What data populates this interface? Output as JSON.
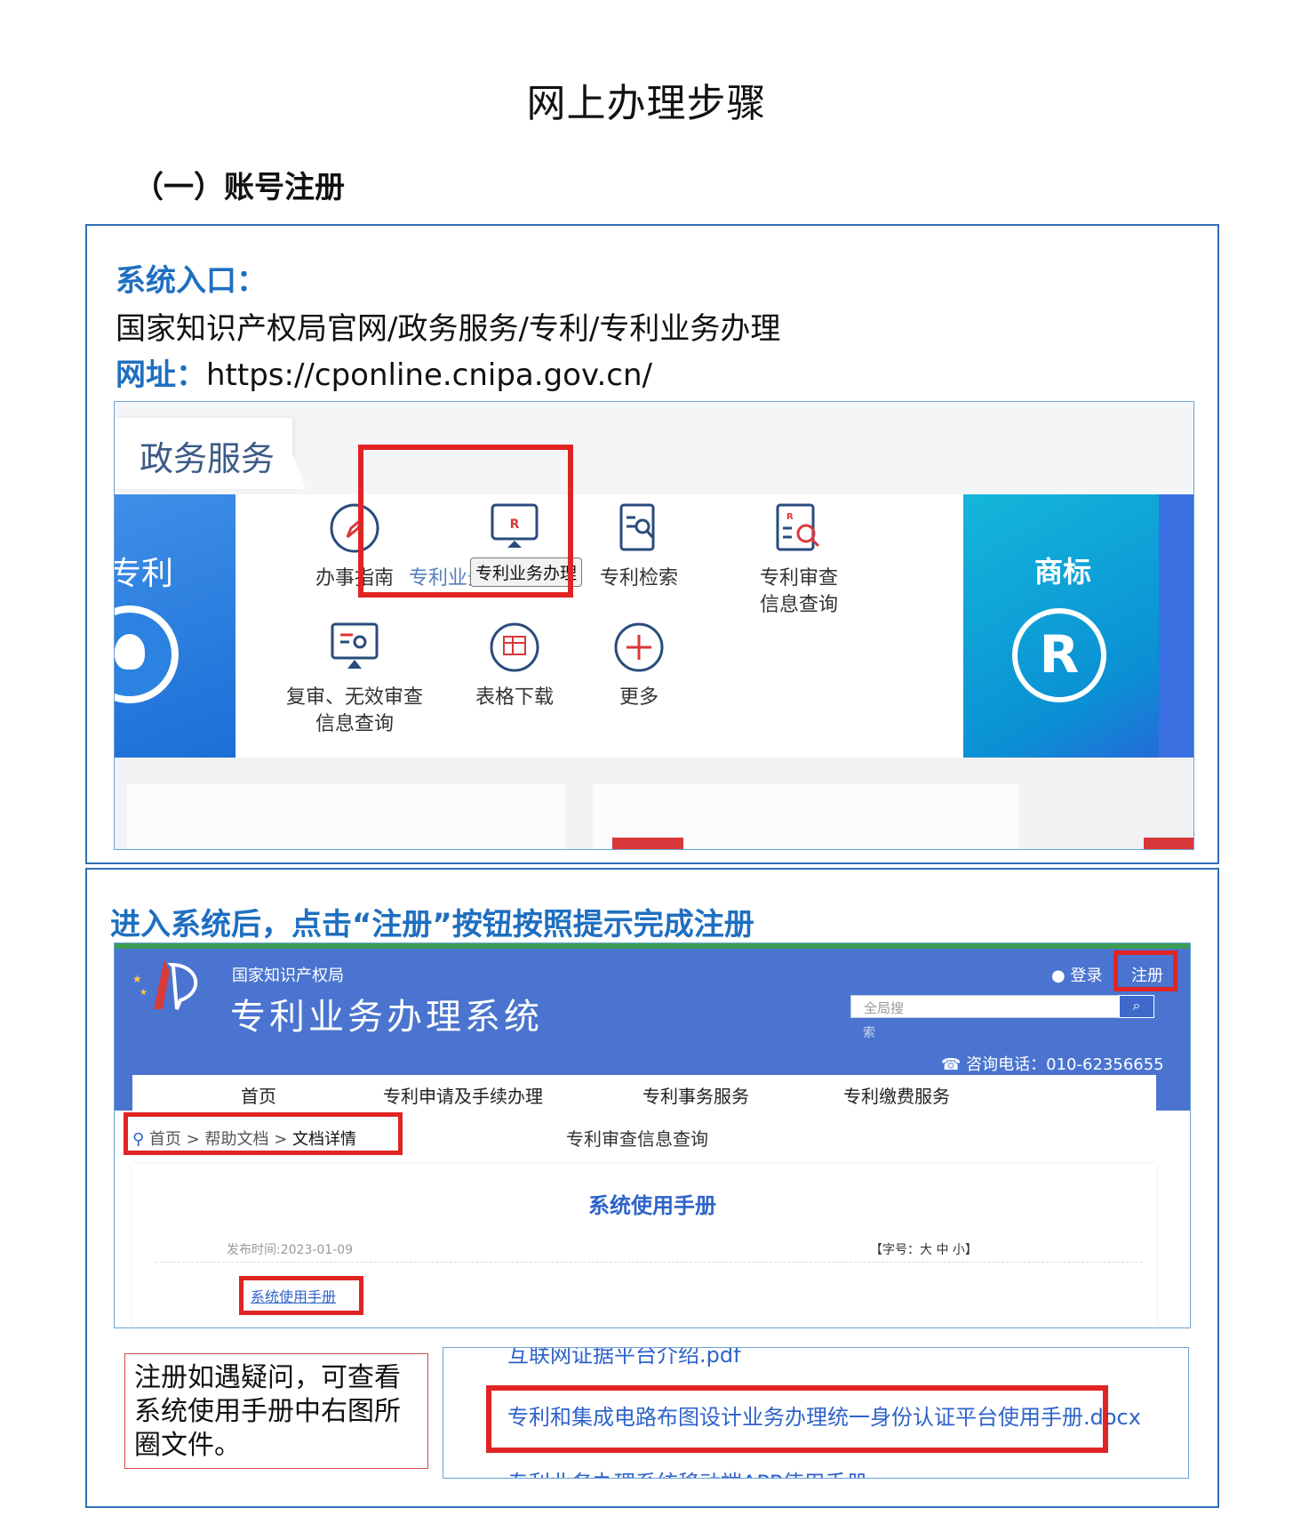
{
  "page_title": "网上办理步骤",
  "section_heading": "（一）账号注册",
  "entry": {
    "label": "系统入口：",
    "path": "国家知识产权局官网/政务服务/专利/专利业务办理",
    "url_label": "网址：",
    "url": "https://cponline.cnipa.gov.cn/"
  },
  "gov_services": {
    "tab_title": "政务服务",
    "left_card": "专利",
    "items": [
      {
        "label": "办事指南",
        "icon": "compass-icon"
      },
      {
        "label": "专利业务",
        "icon": "monitor-r-icon"
      },
      {
        "label": "专利检索",
        "icon": "document-search-icon"
      },
      {
        "label": "专利审查",
        "label2": "信息查询",
        "icon": "review-search-icon"
      },
      {
        "label": "复审、无效审查",
        "label2": "信息查询",
        "icon": "screen-search-icon"
      },
      {
        "label": "表格下载",
        "icon": "table-download-icon"
      },
      {
        "label": "更多",
        "icon": "plus-circle-icon"
      }
    ],
    "tooltip": "专利业务办理",
    "trademark_card": "商标",
    "trademark_symbol": "R"
  },
  "step_text": "进入系统后，点击“注册”按钮按照提示完成注册",
  "system": {
    "org": "国家知识产权局",
    "name": "专利业务办理系统",
    "login": "登录",
    "register": "注册",
    "search_placeholder": "全局搜",
    "search_sub": "索",
    "hotline": "咨询电话：010-62356655",
    "nav": [
      "首页",
      "专利申请及手续办理",
      "专利事务服务",
      "专利缴费服务"
    ],
    "breadcrumb": {
      "home": "首页",
      "sep": ">",
      "help": "帮助文档",
      "current": "文档详情"
    },
    "center_tab": "专利审查信息查询",
    "manual_title": "系统使用手册",
    "publish_time": "发布时间:2023-01-09",
    "font_size_control": "【字号：大 中 小】",
    "manual_link": "系统使用手册"
  },
  "note": "注册如遇疑问，可查看系统使用手册中右图所圈文件。",
  "files": {
    "top_partial": "互联网证据平台介绍.pdf",
    "highlighted": "专利和集成电路布图设计业务办理统一身份认证平台使用手册.docx",
    "bottom_partial": "专利业务办理系统移动端APP使用手册"
  },
  "colors": {
    "accent_blue": "#1f6fc0",
    "highlight_red": "#e02424",
    "header_blue": "#4a74cf"
  }
}
